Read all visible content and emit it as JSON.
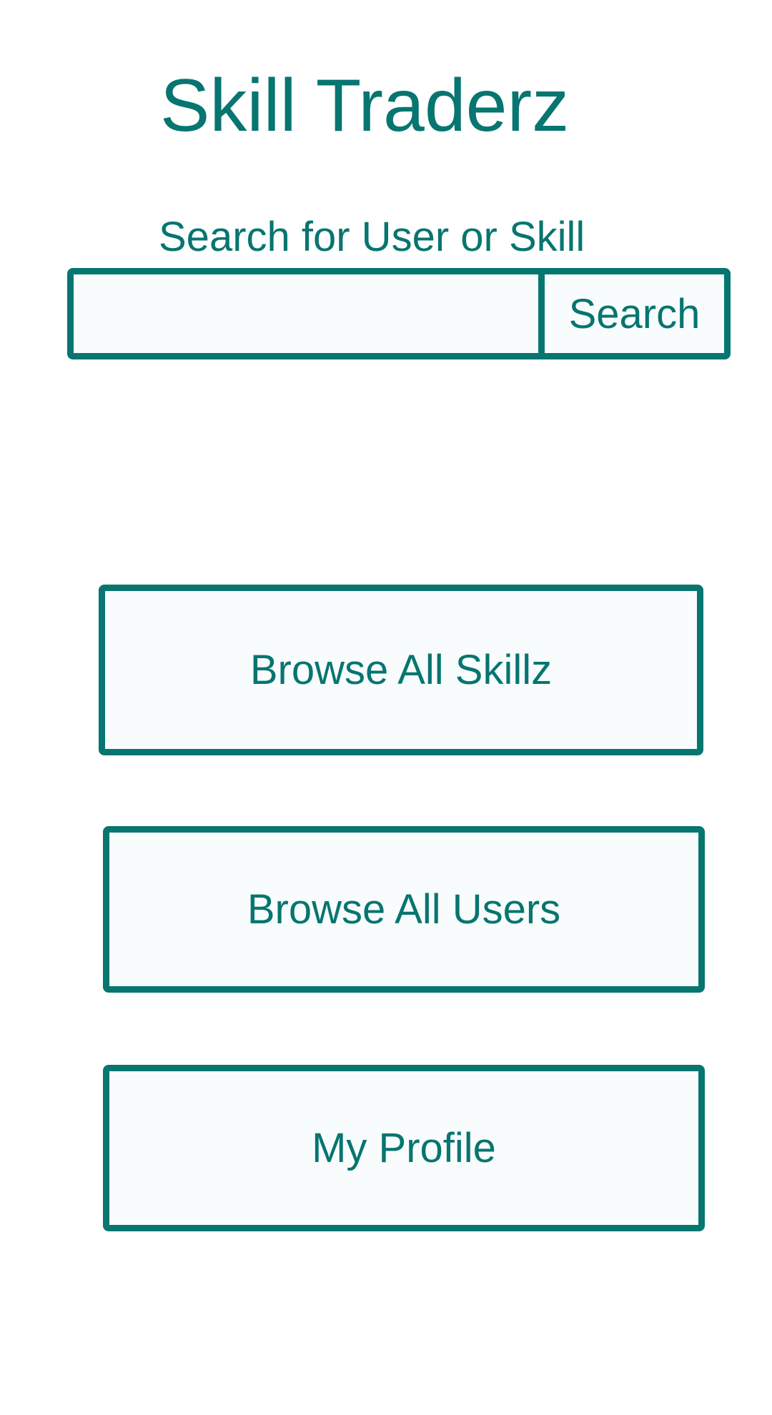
{
  "app": {
    "title": "Skill Traderz"
  },
  "search": {
    "label": "Search for User or Skill",
    "value": "",
    "placeholder": "",
    "button_label": "Search"
  },
  "nav": {
    "browse_skillz": "Browse All Skillz",
    "browse_users": "Browse All Users",
    "my_profile": "My Profile"
  },
  "colors": {
    "accent": "#077570",
    "button_fill": "#f8fcfd",
    "background": "#ffffff"
  }
}
